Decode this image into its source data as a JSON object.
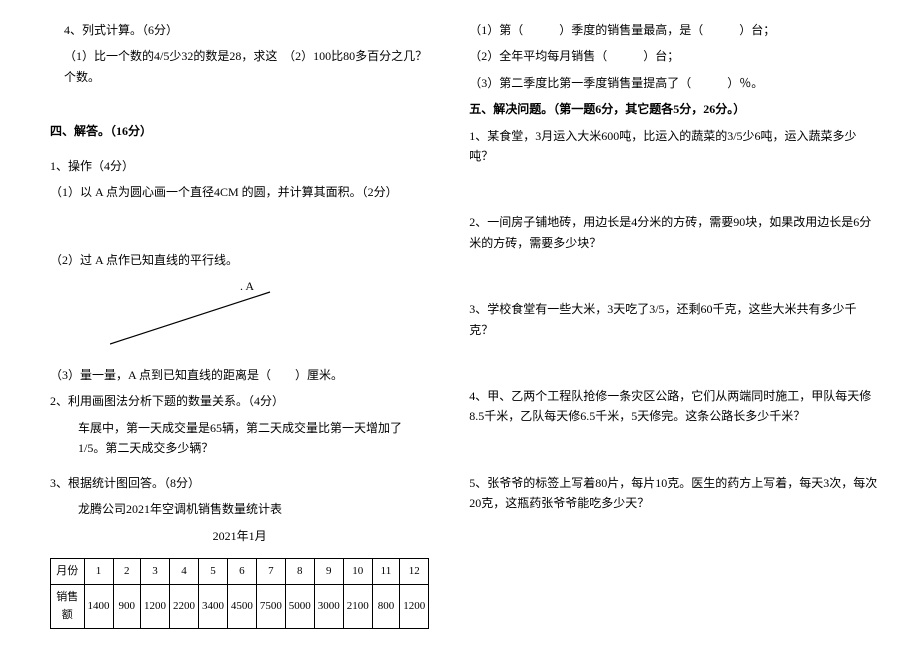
{
  "left": {
    "q4_title": "4、列式计算。（6分）",
    "q4_1": "（1）比一个数的4/5少32的数是28，求这个数。",
    "q4_2": "（2）100比80多百分之几？",
    "sec4_title": "四、解答。（16分）",
    "op_title": "1、操作（4分）",
    "op_1": "（1）以 A 点为圆心画一个直径4CM 的圆，并计算其面积。（2分）",
    "op_2": "（2）过 A 点作已知直线的平行线。",
    "op_2_label": ". A",
    "op_3": "（3）量一量，A 点到已知直线的距离是（　　）厘米。",
    "q2_title": "2、利用画图法分析下题的数量关系。（4分）",
    "q2_body": "车展中，第一天成交量是65辆，第二天成交量比第一天增加了1/5。第二天成交多少辆？",
    "q3_title": "3、根据统计图回答。（8分）",
    "q3_caption": "龙腾公司2021年空调机销售数量统计表",
    "q3_date": "2021年1月",
    "table": {
      "head_month": "月份",
      "head_sales": "销售额",
      "months": [
        "1",
        "2",
        "3",
        "4",
        "5",
        "6",
        "7",
        "8",
        "9",
        "10",
        "11",
        "12"
      ],
      "values": [
        "1400",
        "900",
        "1200",
        "2200",
        "3400",
        "4500",
        "7500",
        "5000",
        "3000",
        "2100",
        "800",
        "1200"
      ]
    }
  },
  "right": {
    "r1": "（1）第（　　　）季度的销售量最高，是（　　　）台；",
    "r2": "（2）全年平均每月销售（　　　）台；",
    "r3": "（3）第二季度比第一季度销售量提高了（　　　）％。",
    "sec5_title": "五、解决问题。（第一题6分，其它题各5分，26分。）",
    "p1": "1、某食堂，3月运入大米600吨，比运入的蔬菜的3/5少6吨，运入蔬菜多少吨？",
    "p2": "2、一间房子铺地砖，用边长是4分米的方砖，需要90块，如果改用边长是6分米的方砖，需要多少块？",
    "p3": "3、学校食堂有一些大米，3天吃了3/5，还剩60千克，这些大米共有多少千克？",
    "p4": "4、甲、乙两个工程队抢修一条灾区公路，它们从两端同时施工，甲队每天修8.5千米，乙队每天修6.5千米，5天修完。这条公路长多少千米？",
    "p5": "5、张爷爷的标签上写着80片，每片10克。医生的药方上写着，每天3次，每次20克，这瓶药张爷爷能吃多少天？"
  }
}
